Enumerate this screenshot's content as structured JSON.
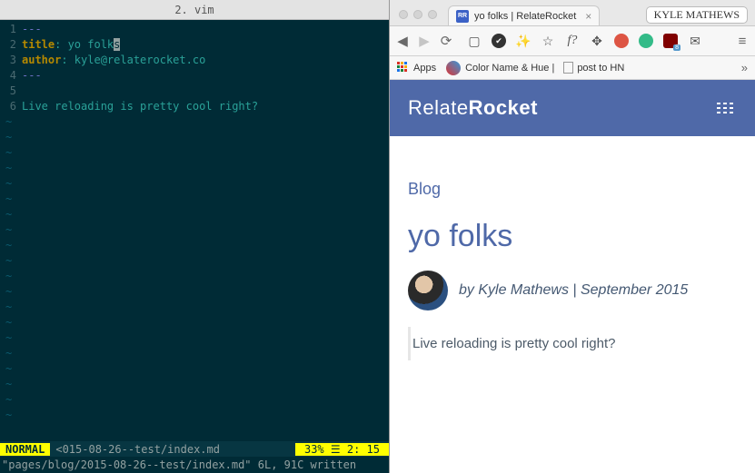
{
  "vim": {
    "title": "2. vim",
    "lines": {
      "l1_dash": "---",
      "l2_key": "title",
      "l2_val": ": yo folk",
      "l2_cursor": "s",
      "l3_key": "author",
      "l3_val": ": kyle@relaterocket.co",
      "l4_dash": "---",
      "l6_text": "Live reloading is pretty cool right?"
    },
    "status": {
      "mode": " NORMAL ",
      "file": "<015-08-26--test/index.md",
      "pct_label": "33% ☰",
      "pos": "2: 15"
    },
    "msg": "\"pages/blog/2015-08-26--test/index.md\" 6L, 91C written"
  },
  "browser": {
    "tab": {
      "favicon": "RR",
      "title": "yo folks | RelateRocket",
      "close": "×"
    },
    "user": "KYLE MATHEWS",
    "bookmarks": {
      "apps": "Apps",
      "color": "Color Name & Hue |",
      "hn": "post to HN",
      "more": "»"
    },
    "page": {
      "brand_a": "Relate",
      "brand_b": "Rocket",
      "crumb": "Blog",
      "title": "yo folks",
      "byline": "by Kyle Mathews | September 2015",
      "body": "Live reloading is pretty cool right?"
    }
  }
}
